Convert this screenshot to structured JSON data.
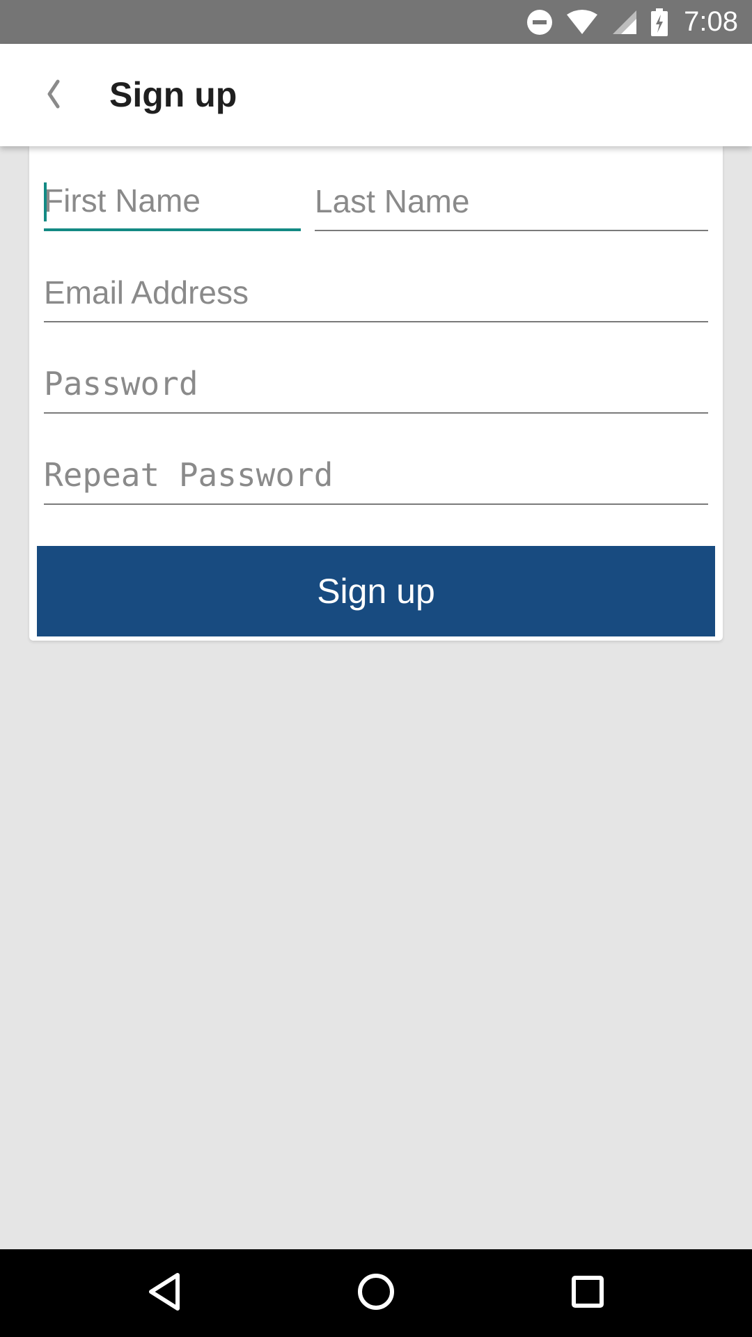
{
  "status_bar": {
    "time": "7:08",
    "icons": [
      "do-not-disturb-icon",
      "wifi-icon",
      "cell-signal-icon",
      "battery-charging-icon"
    ]
  },
  "app_bar": {
    "title": "Sign up",
    "back_icon": "chevron-left-icon"
  },
  "form": {
    "first_name": {
      "value": "",
      "placeholder": "First Name"
    },
    "last_name": {
      "value": "",
      "placeholder": "Last Name"
    },
    "email": {
      "value": "",
      "placeholder": "Email Address"
    },
    "password": {
      "value": "",
      "placeholder": "Password"
    },
    "repeat_password": {
      "value": "",
      "placeholder": "Repeat Password"
    },
    "submit_label": "Sign up"
  },
  "colors": {
    "status_bar": "#757575",
    "accent": "#138a84",
    "button": "#184b80",
    "background": "#e5e5e5"
  },
  "nav_bar": {
    "buttons": [
      "back-triangle-icon",
      "home-circle-icon",
      "recents-square-icon"
    ]
  }
}
